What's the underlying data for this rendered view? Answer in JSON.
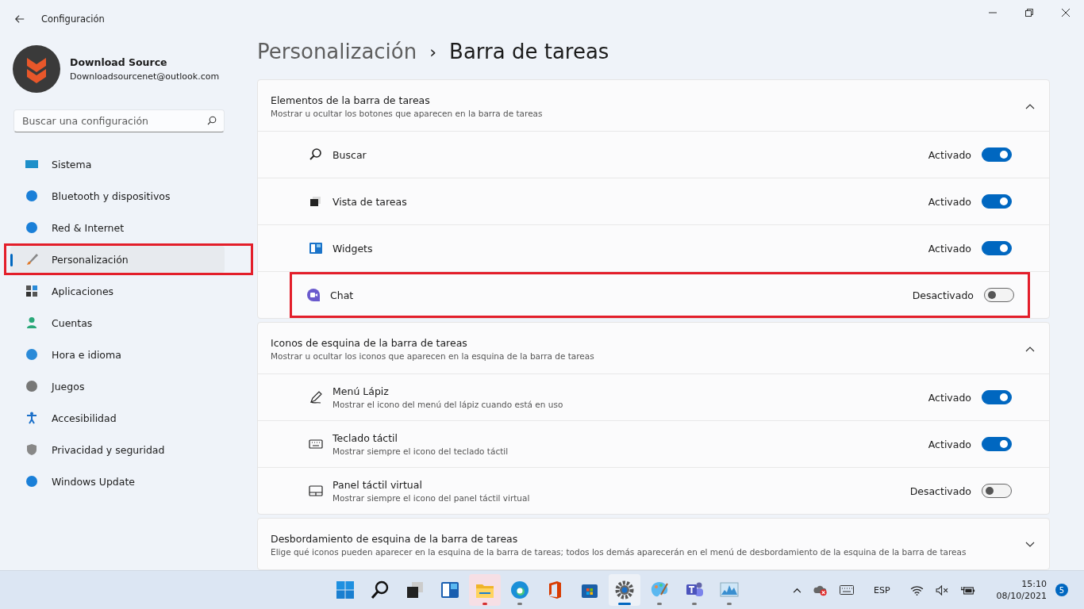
{
  "window": {
    "title": "Configuración"
  },
  "account": {
    "name": "Download Source",
    "email": "Downloadsourcenet@outlook.com"
  },
  "search": {
    "placeholder": "Buscar una configuración"
  },
  "sidebar": {
    "items": [
      {
        "label": "Sistema",
        "selected": false,
        "highlighted": false
      },
      {
        "label": "Bluetooth y dispositivos",
        "selected": false,
        "highlighted": false
      },
      {
        "label": "Red & Internet",
        "selected": false,
        "highlighted": false
      },
      {
        "label": "Personalización",
        "selected": true,
        "highlighted": true
      },
      {
        "label": "Aplicaciones",
        "selected": false,
        "highlighted": false
      },
      {
        "label": "Cuentas",
        "selected": false,
        "highlighted": false
      },
      {
        "label": "Hora e idioma",
        "selected": false,
        "highlighted": false
      },
      {
        "label": "Juegos",
        "selected": false,
        "highlighted": false
      },
      {
        "label": "Accesibilidad",
        "selected": false,
        "highlighted": false
      },
      {
        "label": "Privacidad y seguridad",
        "selected": false,
        "highlighted": false
      },
      {
        "label": "Windows Update",
        "selected": false,
        "highlighted": false
      }
    ]
  },
  "breadcrumb": {
    "parent": "Personalización",
    "separator": "›",
    "current": "Barra de tareas"
  },
  "groups": [
    {
      "title": "Elementos de la barra de tareas",
      "subtitle": "Mostrar u ocultar los botones que aparecen en la barra de tareas",
      "expanded": true,
      "rows": [
        {
          "label": "Buscar",
          "state": "Activado",
          "on": true,
          "highlighted": false
        },
        {
          "label": "Vista de tareas",
          "state": "Activado",
          "on": true,
          "highlighted": false
        },
        {
          "label": "Widgets",
          "state": "Activado",
          "on": true,
          "highlighted": false
        },
        {
          "label": "Chat",
          "state": "Desactivado",
          "on": false,
          "highlighted": true
        }
      ]
    },
    {
      "title": "Iconos de esquina de la barra de tareas",
      "subtitle": "Mostrar u ocultar los iconos que aparecen en la esquina de la barra de tareas",
      "expanded": true,
      "rows": [
        {
          "label": "Menú Lápiz",
          "description": "Mostrar el icono del menú del lápiz cuando está en uso",
          "state": "Activado",
          "on": true,
          "highlighted": false
        },
        {
          "label": "Teclado táctil",
          "description": "Mostrar siempre el icono del teclado táctil",
          "state": "Activado",
          "on": true,
          "highlighted": false
        },
        {
          "label": "Panel táctil virtual",
          "description": "Mostrar siempre el icono del panel táctil virtual",
          "state": "Desactivado",
          "on": false,
          "highlighted": false
        }
      ]
    },
    {
      "title": "Desbordamiento de esquina de la barra de tareas",
      "subtitle": "Elige qué iconos pueden aparecer en la esquina de la barra de tareas; todos los demás aparecerán en el menú de desbordamiento de la esquina de la barra de tareas",
      "expanded": false
    }
  ],
  "taskbar": {
    "apps": [
      {
        "running": false,
        "attention": false,
        "selected": false
      },
      {
        "running": false,
        "attention": false,
        "selected": false
      },
      {
        "running": false,
        "attention": false,
        "selected": false
      },
      {
        "running": false,
        "attention": false,
        "selected": false
      },
      {
        "running": true,
        "attention": true,
        "selected": false
      },
      {
        "running": true,
        "attention": false,
        "selected": false
      },
      {
        "running": false,
        "attention": false,
        "selected": false
      },
      {
        "running": false,
        "attention": false,
        "selected": false
      },
      {
        "running": true,
        "attention": false,
        "selected": true
      },
      {
        "running": true,
        "attention": false,
        "selected": false
      },
      {
        "running": true,
        "attention": false,
        "selected": false
      },
      {
        "running": true,
        "attention": false,
        "selected": false
      }
    ],
    "language": "ESP",
    "time": "15:10",
    "date": "08/10/2021",
    "notifications": "5"
  }
}
